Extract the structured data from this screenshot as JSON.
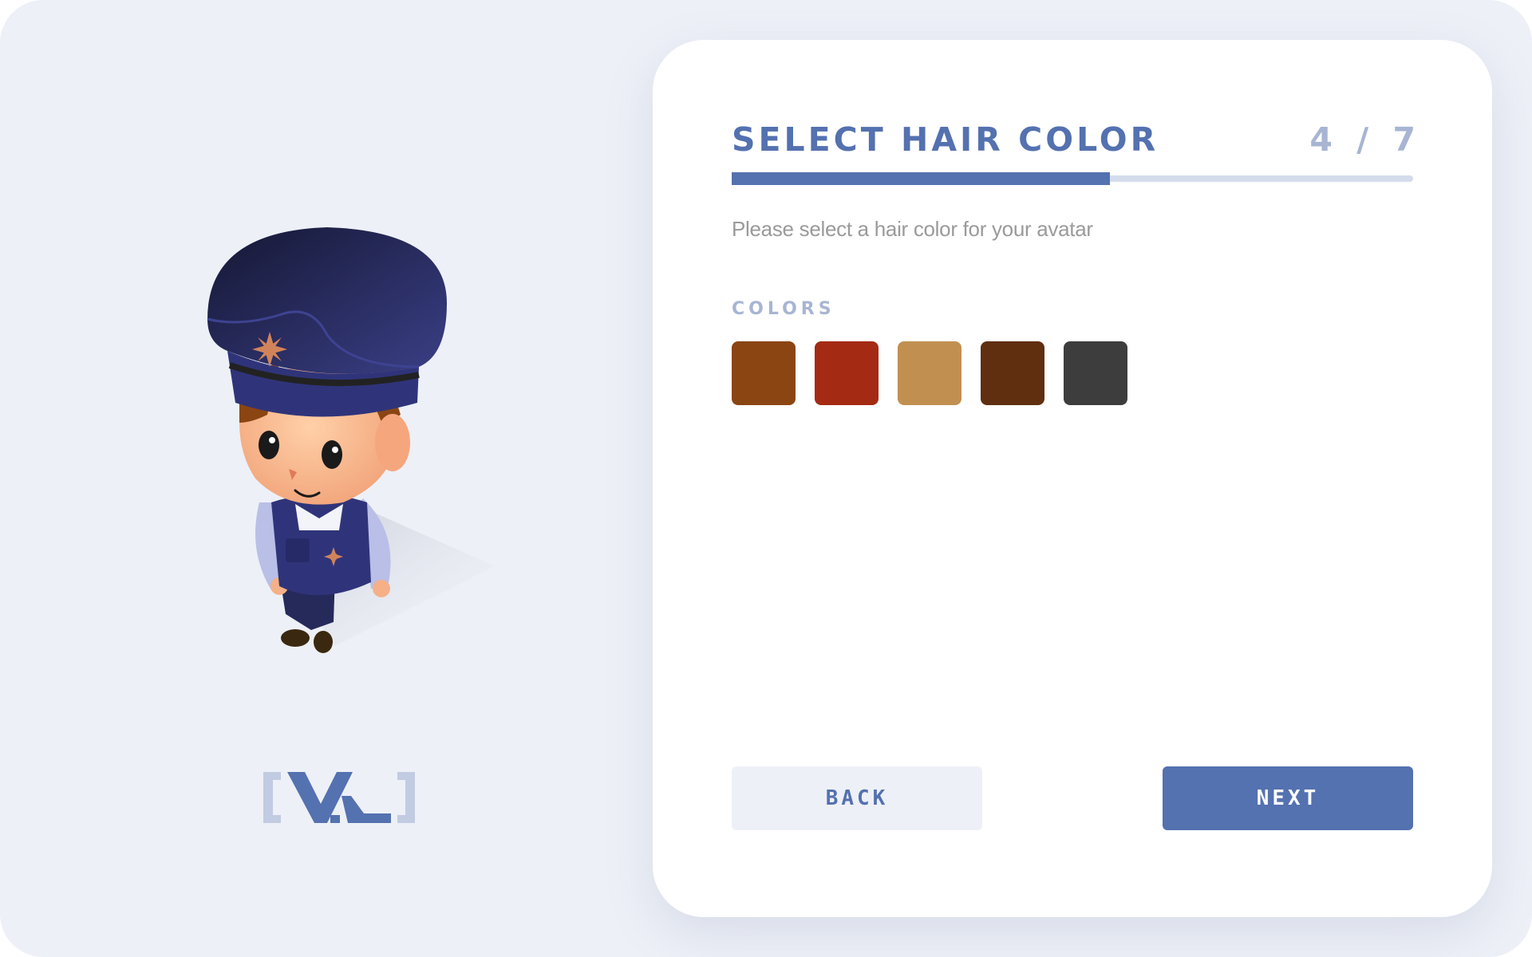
{
  "header": {
    "title": "SELECT HAIR COLOR",
    "step": "4 / 7"
  },
  "progress": {
    "fraction": 0.555
  },
  "subtitle": "Please select a hair color for your avatar",
  "colors": {
    "label": "COLORS",
    "swatches": [
      {
        "name": "hair-color-auburn",
        "hex": "#8b4513"
      },
      {
        "name": "hair-color-red",
        "hex": "#a52a13"
      },
      {
        "name": "hair-color-blonde",
        "hex": "#c19050"
      },
      {
        "name": "hair-color-dark-brown",
        "hex": "#5f2f10"
      },
      {
        "name": "hair-color-black",
        "hex": "#3d3d3d"
      }
    ]
  },
  "buttons": {
    "back": "BACK",
    "next": "NEXT"
  },
  "theme": {
    "accent": "#5471b0",
    "muted": "#a7b5d3",
    "background": "#edf0f7"
  }
}
